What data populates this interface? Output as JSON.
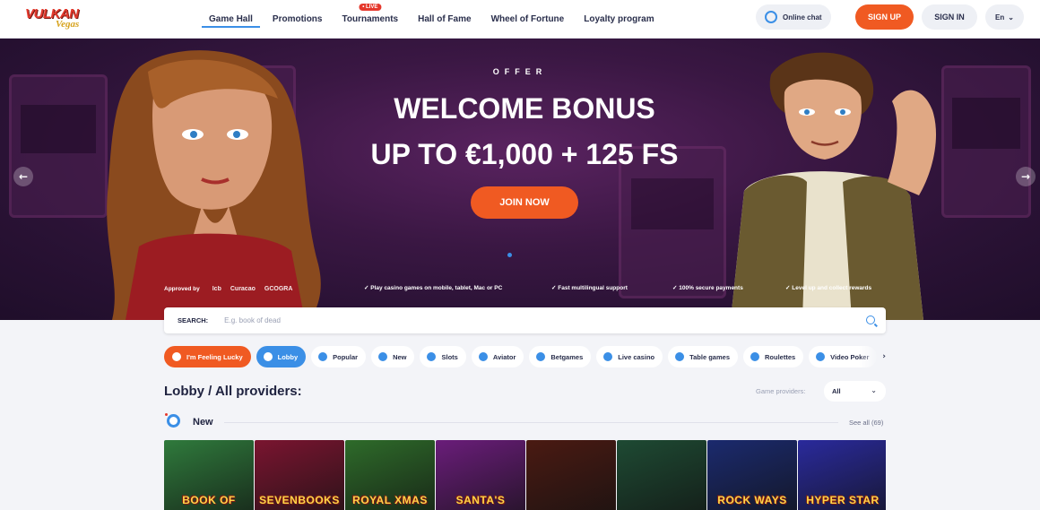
{
  "header": {
    "logo_main": "VULKAN",
    "logo_sub": "Vegas",
    "nav": [
      {
        "label": "Game Hall",
        "active": true
      },
      {
        "label": "Promotions"
      },
      {
        "label": "Tournaments",
        "badge": "• LIVE"
      },
      {
        "label": "Hall of Fame"
      },
      {
        "label": "Wheel of Fortune"
      },
      {
        "label": "Loyalty program"
      }
    ],
    "chat_label": "Online chat",
    "signup_label": "SIGN UP",
    "signin_label": "SIGN IN",
    "lang_label": "En"
  },
  "hero": {
    "offer_label": "OFFER",
    "title": "WELCOME BONUS",
    "subtitle": "UP TO €1,000 + 125 FS",
    "cta_label": "JOIN NOW",
    "approved_label": "Approved by",
    "regulators": [
      "lcb",
      "Curacao",
      "GCOGRA"
    ],
    "features": [
      "Play casino games on mobile, tablet, Mac or PC",
      "Fast multilingual support",
      "100% secure payments",
      "Level up and collect rewards"
    ]
  },
  "search": {
    "label": "SEARCH:",
    "placeholder": "E.g. book of dead"
  },
  "categories": [
    {
      "label": "I'm Feeling Lucky",
      "icon": "clover-icon",
      "style": "lucky"
    },
    {
      "label": "Lobby",
      "icon": "lobby-icon",
      "style": "lobby"
    },
    {
      "label": "Popular",
      "icon": "heart-icon"
    },
    {
      "label": "New",
      "icon": "new-icon"
    },
    {
      "label": "Slots",
      "icon": "slots-icon"
    },
    {
      "label": "Aviator",
      "icon": "aviator-icon"
    },
    {
      "label": "Betgames",
      "icon": "betgames-icon"
    },
    {
      "label": "Live casino",
      "icon": "live-icon"
    },
    {
      "label": "Table games",
      "icon": "club-icon"
    },
    {
      "label": "Roulettes",
      "icon": "roulette-icon"
    },
    {
      "label": "Video Poker",
      "icon": "video-icon"
    }
  ],
  "lobby": {
    "title": "Lobby / All providers:",
    "providers_label": "Game providers:",
    "providers_value": "All"
  },
  "new_section": {
    "title": "New",
    "see_all": "See all (69)"
  },
  "games": [
    {
      "title": "BOOK OF",
      "tag": "",
      "bg": "#2f7a3c"
    },
    {
      "title": "SEVENBOOKS",
      "tag": "",
      "bg": "#7a1530"
    },
    {
      "title": "ROYAL XMAS",
      "tag": "",
      "bg": "#2e6b2a"
    },
    {
      "title": "SANTA'S",
      "tag": "",
      "bg": "#6a1d7a"
    },
    {
      "title": "",
      "tag": "",
      "bg": "#4a1a12"
    },
    {
      "title": "",
      "tag": "",
      "bg": "#1e4a33"
    },
    {
      "title": "ROCK WAYS",
      "tag": "",
      "bg": "#1b2a6e"
    },
    {
      "title": "HYPER STAR",
      "tag": "",
      "bg": "#2a2a9c"
    }
  ],
  "colors": {
    "accent": "#f05a22",
    "primary": "#3b8fe6"
  }
}
